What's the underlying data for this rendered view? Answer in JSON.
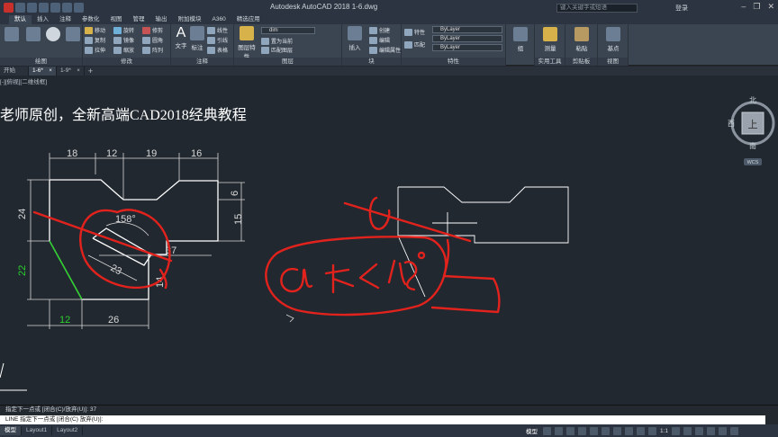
{
  "app": {
    "title": "Autodesk AutoCAD 2018    1-6.dwg",
    "search_placeholder": "键入关键字或短语",
    "login": "登录"
  },
  "menu": [
    "默认",
    "插入",
    "注释",
    "参数化",
    "视图",
    "管理",
    "输出",
    "附加模块",
    "A360",
    "精选应用"
  ],
  "ribbon": {
    "draw_label": "绘图",
    "modify_label": "修改",
    "annotate_label": "注释",
    "layers_label": "图层",
    "block_label": "块",
    "properties_label": "特性",
    "utilities_label": "实用工具",
    "clipboard_label": "剪贴板",
    "view_label": "视图",
    "modify_buttons": [
      "移动",
      "旋转",
      "修剪",
      "复制",
      "镜像",
      "圆角",
      "拉伸",
      "缩放",
      "阵列"
    ],
    "annot_buttons": [
      "文字",
      "标注",
      "线性",
      "引线",
      "表格"
    ],
    "layer_buttons": [
      "图层特性",
      "置为当前",
      "匹配图层"
    ],
    "layer_combo": "dim",
    "block_buttons": [
      "插入",
      "创建",
      "编辑",
      "编辑属性"
    ],
    "prop_buttons": [
      "特性",
      "匹配"
    ],
    "bylayer": [
      "ByLayer",
      "ByLayer",
      "ByLayer"
    ],
    "right_buttons": [
      "组",
      "测量",
      "粘贴",
      "基点"
    ]
  },
  "tabs": {
    "start": "开始",
    "file1": "1-6*",
    "file2": "1-9*"
  },
  "view_label": "[-][俯视][二维线框]",
  "heading": "老师原创，全新高端CAD2018经典教程",
  "viewcube": {
    "north": "北",
    "south": "南",
    "west": "西",
    "east": "东",
    "top": "上",
    "wcs": "WCS"
  },
  "dims": {
    "d18": "18",
    "d12": "12",
    "d19": "19",
    "d16": "16",
    "d6": "6",
    "d15": "15",
    "d24": "24",
    "d22": "22",
    "d37": "37",
    "d23": "23",
    "d14": "14",
    "d158": "158°",
    "d12b": "12",
    "d26": "26"
  },
  "handwriting": "@ 长 < 158°",
  "command": {
    "history": "指定下一点或 [闭合(C)/放弃(U)]: 37",
    "prompt": "LINE 指定下一点或 [闭合(C) 放弃(U)]:"
  },
  "layouts": [
    "模型",
    "Layout1",
    "Layout2"
  ],
  "status": {
    "model": "模型",
    "scale": "1:1"
  },
  "colors": {
    "canvas": "#212830",
    "white_line": "#ffffff",
    "dim_line": "#d9d9d9",
    "green": "#2bd12b",
    "red_ink": "#e2221c"
  }
}
